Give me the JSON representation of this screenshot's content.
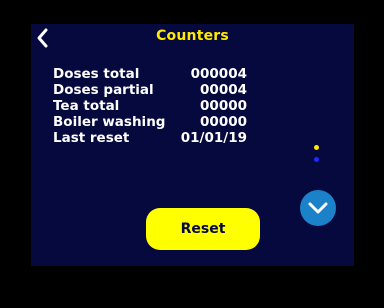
{
  "header": {
    "title": "Counters"
  },
  "counters": [
    {
      "label": "Doses total",
      "value": "000004"
    },
    {
      "label": "Doses partial",
      "value": "00004"
    },
    {
      "label": "Tea total",
      "value": "00000"
    },
    {
      "label": "Boiler washing",
      "value": "00000"
    },
    {
      "label": "Last reset",
      "value": "01/01/19"
    }
  ],
  "actions": {
    "reset_label": "Reset"
  },
  "icons": {
    "back": "back-chevron-icon",
    "down": "chevron-down-icon"
  },
  "pager": {
    "current_page": 1,
    "total_pages": 2
  },
  "colors": {
    "background": "#05093d",
    "accent": "#ffea00",
    "button": "#ffff00",
    "down_button": "#1b82c9",
    "text": "#ffffff",
    "page_dot_active": "#ffea00",
    "page_dot_inactive": "#1a2cff"
  }
}
